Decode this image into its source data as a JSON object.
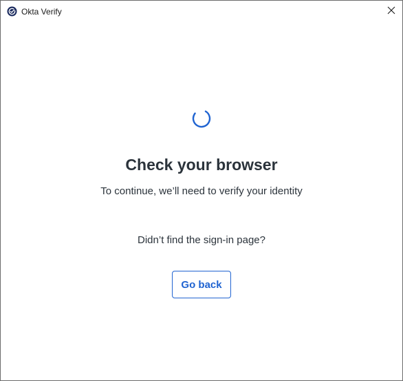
{
  "window": {
    "title": "Okta Verify",
    "app_icon": "okta-verify-check-icon",
    "close_icon": "close-icon"
  },
  "main": {
    "spinner_icon": "loading-spinner-icon",
    "heading": "Check your browser",
    "subtext": "To continue, we’ll need to verify your identity",
    "prompt": "Didn’t find the sign-in page?",
    "go_back_label": "Go back"
  },
  "colors": {
    "accent": "#1f63d1",
    "text": "#2b333b"
  }
}
